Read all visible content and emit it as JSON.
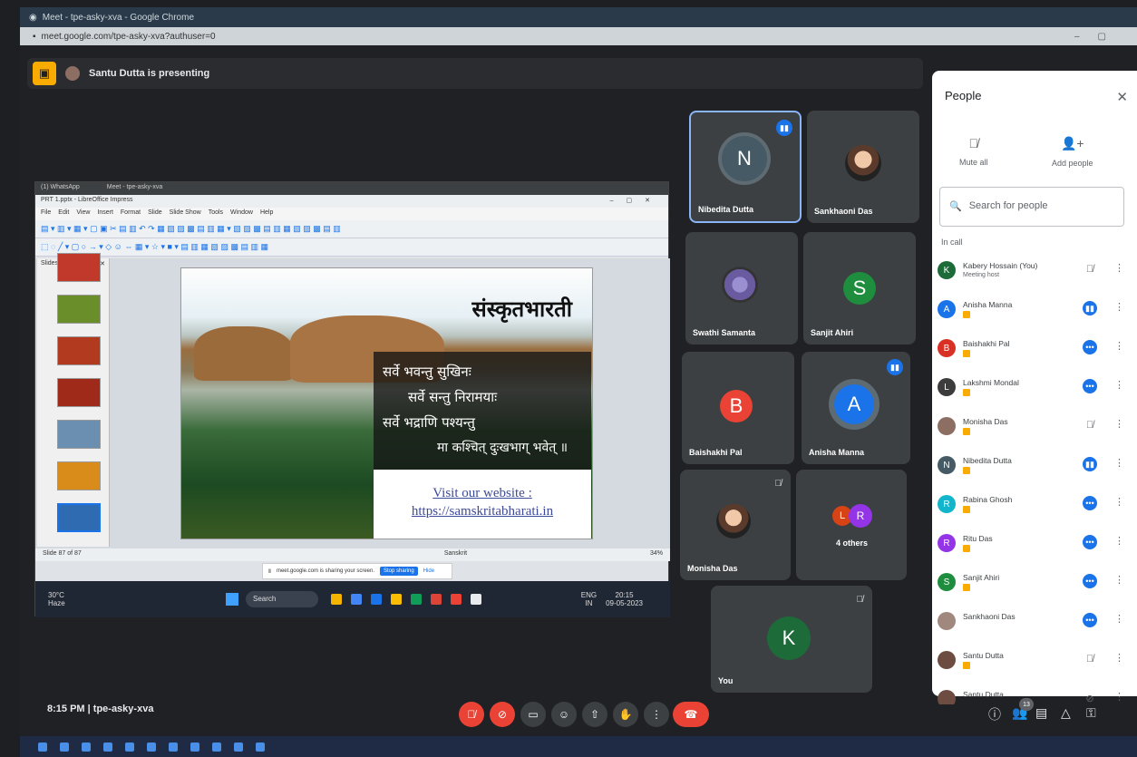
{
  "browser": {
    "title": "Meet - tpe-asky-xva - Google Chrome",
    "url": "meet.google.com/tpe-asky-xva?authuser=0"
  },
  "presenting_banner": "Santu Dutta is presenting",
  "shared_screen": {
    "tabs": [
      "(1) WhatsApp",
      "Meet - tpe-asky-xva"
    ],
    "window_title": "PRT 1.pptx - LibreOffice Impress",
    "menu": [
      "File",
      "Edit",
      "View",
      "Insert",
      "Format",
      "Slide",
      "Slide Show",
      "Tools",
      "Window",
      "Help"
    ],
    "slides_panel_label": "Slides",
    "slide_title": "संस्कृतभारती",
    "verse": [
      "सर्वे भवन्तु सुखिनः",
      "सर्वे सन्तु निरामयाः",
      "सर्वे भद्राणि पश्यन्तु",
      "मा कश्चित् दुःखभाग् भवेत् ॥"
    ],
    "website_label": "Visit our website :",
    "website_url": "https://samskritabharati.in",
    "status_slide": "Slide 87 of 87",
    "status_lang": "Sanskrit",
    "status_zoom": "34%",
    "sharing_notice": "meet.google.com is sharing your screen.",
    "stop_sharing": "Stop sharing",
    "hide": "Hide",
    "weather_temp": "30°C",
    "weather_desc": "Haze",
    "taskbar_search": "Search",
    "tray_lang": "ENG",
    "tray_region": "IN",
    "tray_time": "20:15",
    "tray_date": "09-05-2023"
  },
  "tiles": [
    {
      "name": "Nibedita Dutta",
      "initial": "N"
    },
    {
      "name": "Sankhaoni Das"
    },
    {
      "name": "Swathi Samanta"
    },
    {
      "name": "Sanjit Ahiri",
      "initial": "S"
    },
    {
      "name": "Baishakhi Pal",
      "initial": "B"
    },
    {
      "name": "Anisha Manna",
      "initial": "A"
    },
    {
      "name": "Monisha Das"
    },
    {
      "name": "4 others",
      "initials": [
        "L",
        "R"
      ]
    },
    {
      "name": "You",
      "initial": "K"
    }
  ],
  "people_panel": {
    "title": "People",
    "mute_all": "Mute all",
    "add_people": "Add people",
    "search_placeholder": "Search for people",
    "in_call": "In call",
    "list": [
      {
        "initial": "K",
        "name": "Kabery Hossain (You)",
        "sub": "Meeting host",
        "color": "#1e6b3a"
      },
      {
        "initial": "A",
        "name": "Anisha Manna",
        "color": "#1a73e8"
      },
      {
        "initial": "B",
        "name": "Baishakhi Pal",
        "color": "#d93025"
      },
      {
        "initial": "L",
        "name": "Lakshmi Mondal",
        "color": "#3c3c3c"
      },
      {
        "initial": "",
        "name": "Monisha Das",
        "color": "#8d6e63"
      },
      {
        "initial": "N",
        "name": "Nibedita Dutta",
        "color": "#455a64"
      },
      {
        "initial": "R",
        "name": "Rabina Ghosh",
        "color": "#12b5cb"
      },
      {
        "initial": "R",
        "name": "Ritu Das",
        "color": "#9334e6"
      },
      {
        "initial": "S",
        "name": "Sanjit Ahiri",
        "color": "#1e8e3e"
      },
      {
        "initial": "",
        "name": "Sankhaoni Das",
        "color": "#a1887f"
      },
      {
        "initial": "",
        "name": "Santu Dutta",
        "color": "#6d4c41"
      },
      {
        "initial": "",
        "name": "Santu Dutta",
        "color": "#6d4c41"
      }
    ]
  },
  "bottom_bar": {
    "time": "8:15 PM",
    "meeting_code": "tpe-asky-xva",
    "participants_count": "13"
  }
}
